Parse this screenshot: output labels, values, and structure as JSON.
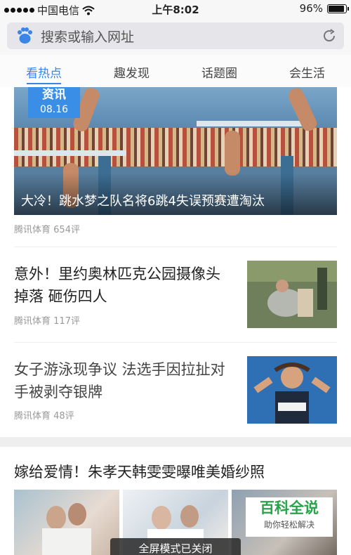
{
  "status_bar": {
    "carrier": "中国电信",
    "time": "上午8:02",
    "battery": "96%",
    "battery_level": 0.96
  },
  "search": {
    "placeholder": "搜索或输入网址",
    "logo_icon": "baidu-paw-icon",
    "refresh_icon": "refresh-icon"
  },
  "tabs": [
    {
      "label": "看热点",
      "active": true
    },
    {
      "label": "趣发现",
      "active": false
    },
    {
      "label": "话题圈",
      "active": false
    },
    {
      "label": "会生活",
      "active": false
    }
  ],
  "feed": {
    "hero": {
      "badge_type": "资讯",
      "badge_date": "08.16",
      "title": "大冷！跳水梦之队名将6跳4失误预赛遭淘汰",
      "source": "腾讯体育",
      "comments": "654评"
    },
    "articles": [
      {
        "title": "意外！里约奥林匹克公园摄像头掉落 砸伤四人",
        "source": "腾讯体育",
        "comments": "117评"
      },
      {
        "title": "女子游泳现争议 法选手因拉扯对手被剥夺银牌",
        "source": "腾讯体育",
        "comments": "48评"
      }
    ],
    "gallery": {
      "title": "嫁给爱情！朱孝天韩雯雯曝唯美婚纱照"
    }
  },
  "toast": "全屏模式已关闭",
  "watermark": {
    "title": "百科全说",
    "subtitle": "助你轻松解决"
  },
  "colors": {
    "accent": "#3a85e6",
    "watermark_green": "#27a34a"
  }
}
